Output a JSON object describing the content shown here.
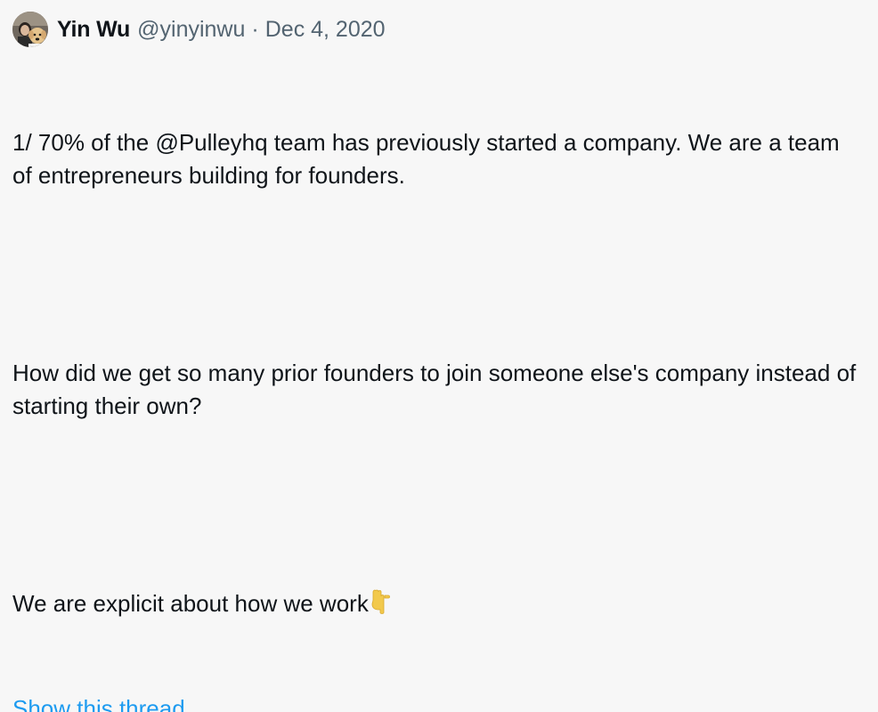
{
  "tweet": {
    "author_name": "Yin Wu",
    "author_handle": "@yinyinwu",
    "separator": "·",
    "date": "Dec 4, 2020",
    "paragraphs": [
      "1/ 70% of the @Pulleyhq team has previously started a company. We are a team of entrepreneurs building for founders.",
      "How did we get so many prior founders to join someone else's company instead of starting their own?",
      "We are explicit about how we work"
    ],
    "emoji": "backhand-index-pointing-down",
    "show_thread_label": "Show this thread"
  },
  "colors": {
    "background": "#f7f7f7",
    "text": "#0f1419",
    "secondary": "#536471",
    "link": "#1d9bf0",
    "emoji": "#f2c94c"
  }
}
